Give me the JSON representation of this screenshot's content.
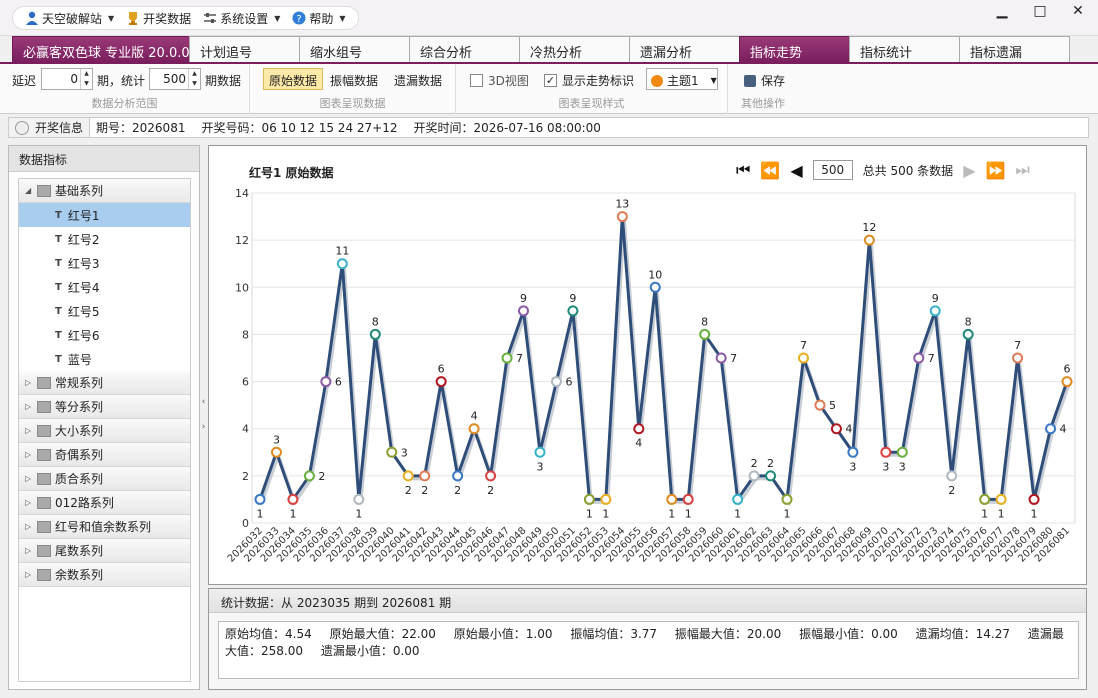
{
  "menu": {
    "app_name": "天空破解站",
    "draw_data": "开奖数据",
    "settings": "系统设置",
    "help": "帮助"
  },
  "window": {
    "minimize": "▁",
    "maximize": "□",
    "close": "✕"
  },
  "tabs": [
    "必赢客双色球 专业版 20.0.0",
    "计划追号",
    "缩水组号",
    "综合分析",
    "冷热分析",
    "遗漏分析",
    "指标走势",
    "指标统计",
    "指标遗漏"
  ],
  "ribbon": {
    "delay_label": "延迟",
    "delay_value": "0",
    "period_label": "期，统计",
    "stat_value": "500",
    "period_data_label": "期数据",
    "group1_caption": "数据分析范围",
    "btn_raw": "原始数据",
    "btn_amp": "振幅数据",
    "btn_miss": "遗漏数据",
    "group2_caption": "图表呈现数据",
    "chk_3d": "3D视图",
    "chk_trend": "显示走势标识",
    "theme": "主题1",
    "group3_caption": "图表呈现样式",
    "save": "保存",
    "group4_caption": "其他操作"
  },
  "info": {
    "button": "开奖信息",
    "period": "期号：2026081",
    "numbers": "开奖号码：06 10 12 15 24 27+12",
    "time": "开奖时间：2026-07-16 08:00:00"
  },
  "left": {
    "title": "数据指标",
    "groups": [
      "常规系列",
      "等分系列",
      "大小系列",
      "奇偶系列",
      "质合系列",
      "012路系列",
      "红号和值余数系列",
      "尾数系列",
      "余数系列"
    ],
    "basic_group": "基础系列",
    "leaf_icon": "T",
    "leaves": [
      "红号1",
      "红号2",
      "红号3",
      "红号4",
      "红号5",
      "红号6",
      "蓝号"
    ]
  },
  "chart": {
    "title": "红号1 原始数据",
    "page_value": "500",
    "total_label": "总共 500 条数据"
  },
  "chart_data": {
    "type": "line",
    "ylim": [
      0,
      14
    ],
    "yticks": [
      0,
      2,
      4,
      6,
      8,
      10,
      12,
      14
    ],
    "grid": "horizontal",
    "x": [
      "2026032",
      "2026033",
      "2026034",
      "2026035",
      "2026036",
      "2026037",
      "2026038",
      "2026039",
      "2026040",
      "2026041",
      "2026042",
      "2026043",
      "2026044",
      "2026045",
      "2026046",
      "2026047",
      "2026048",
      "2026049",
      "2026050",
      "2026051",
      "2026052",
      "2026053",
      "2026054",
      "2026055",
      "2026056",
      "2026057",
      "2026058",
      "2026059",
      "2026060",
      "2026061",
      "2026062",
      "2026063",
      "2026064",
      "2026065",
      "2026066",
      "2026067",
      "2026068",
      "2026069",
      "2026070",
      "2026071",
      "2026072",
      "2026073",
      "2026074",
      "2026075",
      "2026076",
      "2026077",
      "2026078",
      "2026079",
      "2026080",
      "2026081"
    ],
    "values": [
      1,
      3,
      1,
      2,
      6,
      11,
      1,
      8,
      3,
      2,
      2,
      6,
      2,
      4,
      2,
      7,
      9,
      3,
      6,
      9,
      1,
      1,
      13,
      4,
      10,
      1,
      1,
      8,
      7,
      1,
      2,
      2,
      1,
      7,
      5,
      4,
      3,
      12,
      3,
      3,
      7,
      9,
      2,
      8,
      1,
      1,
      7,
      1,
      4,
      6
    ],
    "line_color": "#2e4d78",
    "marker_colors": [
      "#3a78c4",
      "#e08a22",
      "#d94040",
      "#6ab040",
      "#8a5aa6",
      "#38b2c8",
      "#b0b8c0",
      "#1f8a78",
      "#8aa030",
      "#e8b020",
      "#e07a55",
      "#b01820"
    ]
  },
  "stats": {
    "header": "统计数据：从 2023035 期到 2026081 期",
    "items": [
      "原始均值：4.54",
      "原始最大值：22.00",
      "原始最小值：1.00",
      "振幅均值：3.77",
      "振幅最大值：20.00",
      "振幅最小值：0.00",
      "遗漏均值：14.27",
      "遗漏最大值：258.00",
      "遗漏最小值：0.00"
    ]
  }
}
